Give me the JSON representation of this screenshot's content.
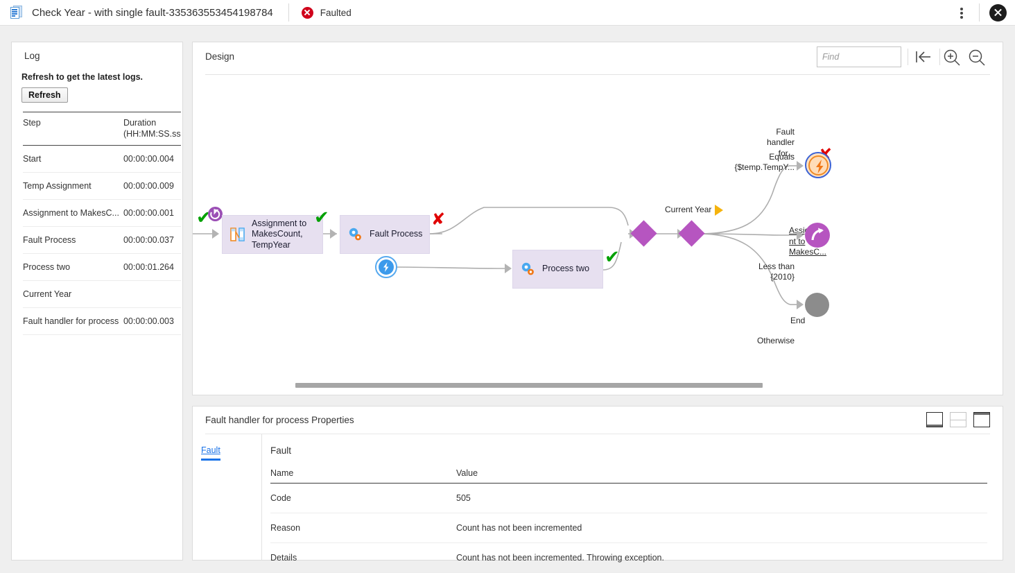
{
  "titlebar": {
    "doc_icon": "document-icon",
    "title": "Check Year - with single fault-335363553454198784",
    "status_icon": "error-circle-icon",
    "status": "Faulted",
    "menu_icon": "kebab-menu-icon",
    "close_icon": "close-icon"
  },
  "log": {
    "panel_title": "Log",
    "hint": "Refresh to get the latest logs.",
    "refresh_label": "Refresh",
    "columns": [
      "Step",
      "Duration (HH:MM:SS.ss"
    ],
    "col_step": "Step",
    "col_duration_l1": "Duration",
    "col_duration_l2": "(HH:MM:SS.ss",
    "rows": [
      {
        "step": "Start",
        "duration": "00:00:00.004"
      },
      {
        "step": "Temp Assignment",
        "duration": "00:00:00.009"
      },
      {
        "step": "Assignment to MakesC...",
        "duration": "00:00:00.001"
      },
      {
        "step": "Fault Process",
        "duration": "00:00:00.037"
      },
      {
        "step": "Process two",
        "duration": "00:00:01.264"
      },
      {
        "step": "Current Year",
        "duration": ""
      },
      {
        "step": "Fault handler for process",
        "duration": "00:00:00.003"
      }
    ]
  },
  "design": {
    "label": "Design",
    "find_placeholder": "Find",
    "find_value": "",
    "fit_icon": "fit-to-screen-icon",
    "zoom_in_icon": "zoom-in-icon",
    "zoom_out_icon": "zoom-out-icon",
    "scrollbar": "horizontal-scrollbar",
    "nodes": {
      "assignment": "Assignment to MakesCount, TempYear",
      "fault_process": "Fault Process",
      "process_two": "Process two",
      "current_year": "Current Year",
      "fault_handler_for": "Fault handler for...",
      "equals_line1": "Equals",
      "equals_line2": "{$temp.TempY...",
      "assignment_link_line1": "Assignme",
      "assignment_link_line2": "nt to",
      "assignment_link_line3": "MakesC...",
      "less_than_line1": "Less than",
      "less_than_line2": "{2010}",
      "otherwise": "Otherwise",
      "end": "End"
    },
    "icons": {
      "start": "start-badge-icon",
      "assignment": "assignment-icon",
      "gear": "process-gear-icon",
      "bolt_blue": "blue-bolt-icon",
      "bolt_orange": "orange-bolt-fault-handler-icon",
      "jump": "jump-arrow-icon",
      "end": "end-circle-icon",
      "decision": "decision-diamond-icon",
      "check": "✔",
      "cross": "✘",
      "play": "play-triangle-icon"
    }
  },
  "properties": {
    "title": "Fault handler for process Properties",
    "layout_icons": [
      "layout-bottom-icon",
      "layout-split-icon",
      "layout-top-icon"
    ],
    "tab": "Fault",
    "section_heading": "Fault",
    "columns": {
      "name": "Name",
      "value": "Value"
    },
    "rows": [
      {
        "name": "Code",
        "value": "505"
      },
      {
        "name": "Reason",
        "value": "Count has not been incremented"
      },
      {
        "name": "Details",
        "value": "Count has not been incremented. Throwing exception."
      }
    ]
  },
  "colors": {
    "accent_blue": "#1a73e8",
    "error_red": "#d0021b",
    "node_fill": "#e7e0f0",
    "diamond": "#b655c0",
    "success_green": "#00a000",
    "play_yellow": "#f5b30d",
    "end_gray": "#8c8c8c"
  }
}
